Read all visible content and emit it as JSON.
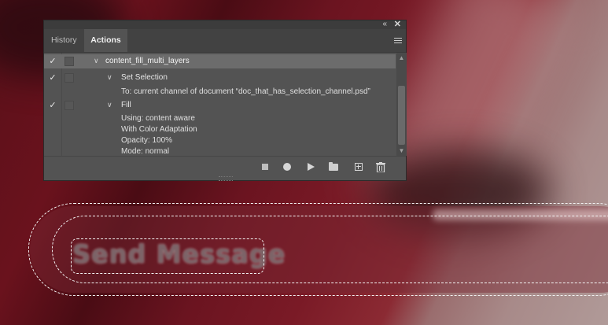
{
  "panel": {
    "collapse_label": "«",
    "close_label": "✕",
    "tabs": [
      {
        "label": "History",
        "active": false
      },
      {
        "label": "Actions",
        "active": true
      }
    ]
  },
  "actions": {
    "set_name": "content_fill_multi_layers",
    "steps": [
      {
        "label": "Set Selection",
        "details": [
          "To: current channel of document “doc_that_has_selection_channel.psd”"
        ]
      },
      {
        "label": "Fill",
        "details": [
          "Using: content aware",
          "With Color Adaptation",
          "Opacity: 100%",
          "Mode: normal"
        ]
      }
    ]
  },
  "checkmark": "✓",
  "chevron": "∨",
  "scroll": {
    "up": "▲",
    "down": "▼"
  },
  "footer_buttons": [
    {
      "name": "stop-icon"
    },
    {
      "name": "record-icon"
    },
    {
      "name": "play-icon"
    },
    {
      "name": "folder-icon"
    },
    {
      "name": "new-action-icon"
    },
    {
      "name": "trash-icon"
    }
  ],
  "canvas": {
    "text": "Send Message",
    "accent_color": "#6a121d"
  }
}
